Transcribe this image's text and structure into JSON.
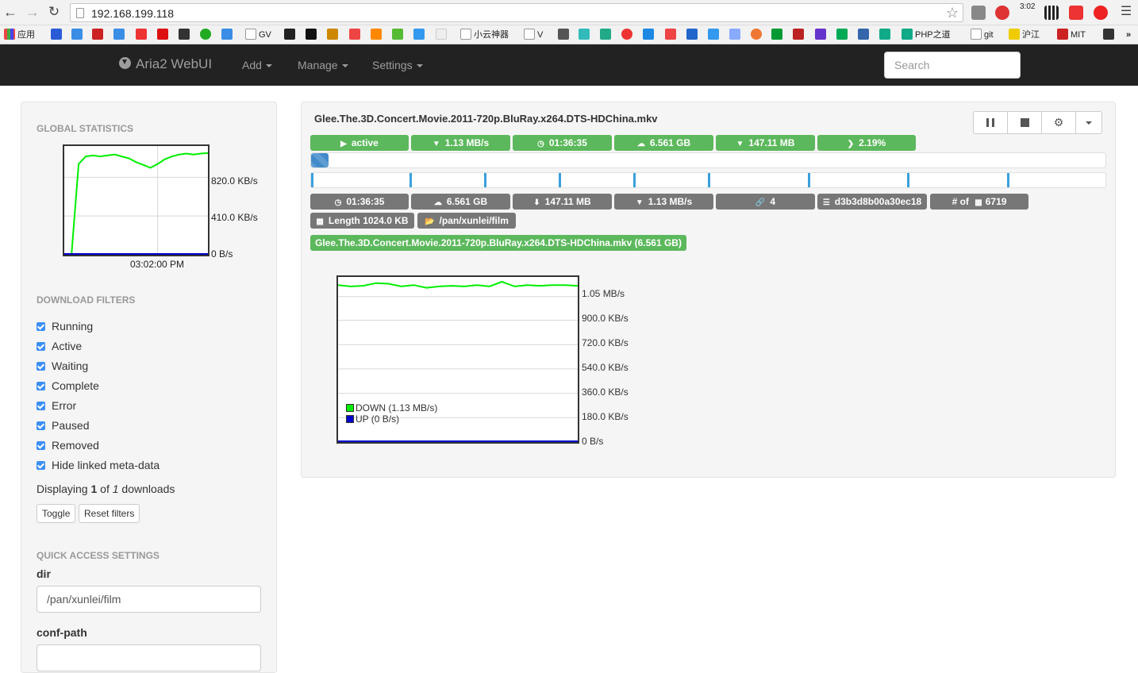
{
  "browser": {
    "url": "192.168.199.118",
    "clock": "3:02",
    "bookmarks": [
      "应用",
      "GV",
      "小云神器",
      "V",
      "PHP之道",
      "git",
      "沪江",
      "MIT"
    ],
    "more": "»"
  },
  "navbar": {
    "brand": "Aria2 WebUI",
    "menu": [
      "Add",
      "Manage",
      "Settings"
    ],
    "search_placeholder": "Search"
  },
  "sidebar": {
    "global_stats_heading": "GLOBAL STATISTICS",
    "global_chart": {
      "y_ticks": [
        "820.0 KB/s",
        "410.0 KB/s",
        "0 B/s"
      ],
      "x_label": "03:02:00 PM"
    },
    "filters_heading": "DOWNLOAD FILTERS",
    "filters": [
      "Running",
      "Active",
      "Waiting",
      "Complete",
      "Error",
      "Paused",
      "Removed",
      "Hide linked meta-data"
    ],
    "displaying": {
      "prefix": "Displaying ",
      "shown": "1",
      "middle": " of ",
      "total": "1",
      "suffix": " downloads"
    },
    "toggle_label": "Toggle",
    "reset_label": "Reset filters",
    "quick_heading": "QUICK ACCESS SETTINGS",
    "dir_label": "dir",
    "dir_value": "/pan/xunlei/film",
    "conf_label": "conf-path"
  },
  "download": {
    "name": "Glee.The.3D.Concert.Movie.2011-720p.BluRay.x264.DTS-HDChina.mkv",
    "status": "active",
    "speed": "1.13 MB/s",
    "eta": "01:36:35",
    "size": "6.561 GB",
    "downloaded": "147.11 MB",
    "percent": "2.19%",
    "progress_fraction": 0.0219,
    "connections": "4",
    "hash": "d3b3d8b00a30ec18",
    "num_pieces_label": "# of",
    "num_pieces": "6719",
    "piece_length_label": "Length",
    "piece_length": "1024.0 KB",
    "path": "/pan/xunlei/film",
    "file_entry": "Glee.The.3D.Concert.Movie.2011-720p.BluRay.x264.DTS-HDChina.mkv (6.561 GB)"
  },
  "chart_data": [
    {
      "type": "line",
      "title": "",
      "x_ticks": [
        "03:02:00 PM"
      ],
      "y_ticks": [
        "0 B/s",
        "410.0 KB/s",
        "820.0 KB/s"
      ],
      "ylim": [
        0,
        1150
      ],
      "y_unit": "KB/s",
      "series": [
        {
          "color": "#00ee00",
          "values": [
            0,
            0,
            960,
            1040,
            1050,
            1040,
            1050,
            1060,
            1040,
            1020,
            980,
            950,
            920,
            960,
            1010,
            1040,
            1060,
            1070,
            1060,
            1070,
            1075
          ]
        },
        {
          "color": "#0000cc",
          "values": [
            0,
            0,
            0,
            0,
            0,
            0,
            0,
            0,
            0,
            0,
            0,
            0,
            0,
            0,
            0,
            0,
            0,
            0,
            0,
            0,
            0
          ]
        }
      ]
    },
    {
      "type": "line",
      "title": "",
      "y_ticks": [
        "0 B/s",
        "180.0 KB/s",
        "360.0 KB/s",
        "540.0 KB/s",
        "720.0 KB/s",
        "900.0 KB/s",
        "1.05 MB/s"
      ],
      "ylim": [
        0,
        1220
      ],
      "y_unit": "KB/s",
      "legend": [
        "DOWN (1.13 MB/s)",
        "UP (0 B/s)"
      ],
      "legend_position": "bottom-left",
      "series": [
        {
          "name": "DOWN (1.13 MB/s)",
          "color": "#00ee00",
          "values": [
            1160,
            1150,
            1155,
            1175,
            1170,
            1150,
            1160,
            1140,
            1150,
            1155,
            1150,
            1160,
            1150,
            1185,
            1150,
            1160,
            1155,
            1160,
            1160,
            1155
          ]
        },
        {
          "name": "UP (0 B/s)",
          "color": "#0000cc",
          "values": [
            0,
            0,
            0,
            0,
            0,
            0,
            0,
            0,
            0,
            0,
            0,
            0,
            0,
            0,
            0,
            0,
            0,
            0,
            0,
            0
          ]
        }
      ]
    }
  ]
}
